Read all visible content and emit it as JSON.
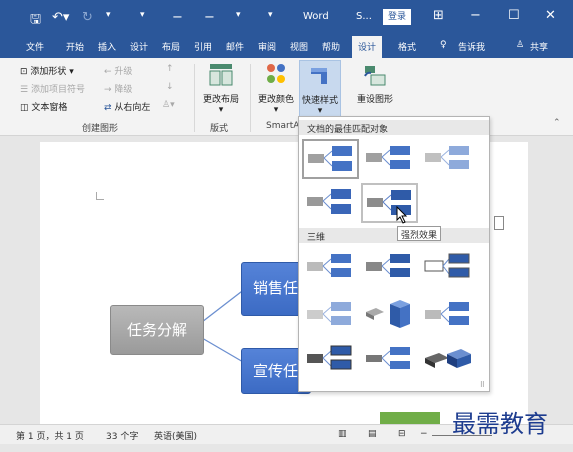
{
  "titlebar": {
    "app_title": "Word",
    "doc_short": "S...",
    "login": "登录"
  },
  "tabs": [
    "文件",
    "开始",
    "插入",
    "设计",
    "布局",
    "引用",
    "邮件",
    "审阅",
    "视图",
    "帮助",
    "设计",
    "格式",
    "告诉我",
    "共享"
  ],
  "ribbon": {
    "add_shape": "添加形状",
    "add_bullet": "添加项目符号",
    "text_pane": "文本窗格",
    "promote": "升级",
    "demote": "降级",
    "rtl": "从右向左",
    "group_create": "创建图形",
    "change_layout": "更改布局",
    "group_layout": "版式",
    "change_colors": "更改颜色",
    "quick_styles": "快速样式",
    "group_smartart": "SmartA",
    "reset_graphic": "重设图形"
  },
  "diagram": {
    "root": "任务分解",
    "child1": "销售任",
    "child2": "宣传任"
  },
  "gallery": {
    "header_best": "文档的最佳匹配对象",
    "header_3d": "三维",
    "tooltip": "强烈效果"
  },
  "status": {
    "pages": "第 1 页，共 1 页",
    "words": "33 个字",
    "language": "英语(美国)"
  },
  "watermark": "最需教育",
  "colors": {
    "accent": "#2b579a",
    "smartart_blue": "#4472c4",
    "root_gray": "#a6a6a6"
  }
}
